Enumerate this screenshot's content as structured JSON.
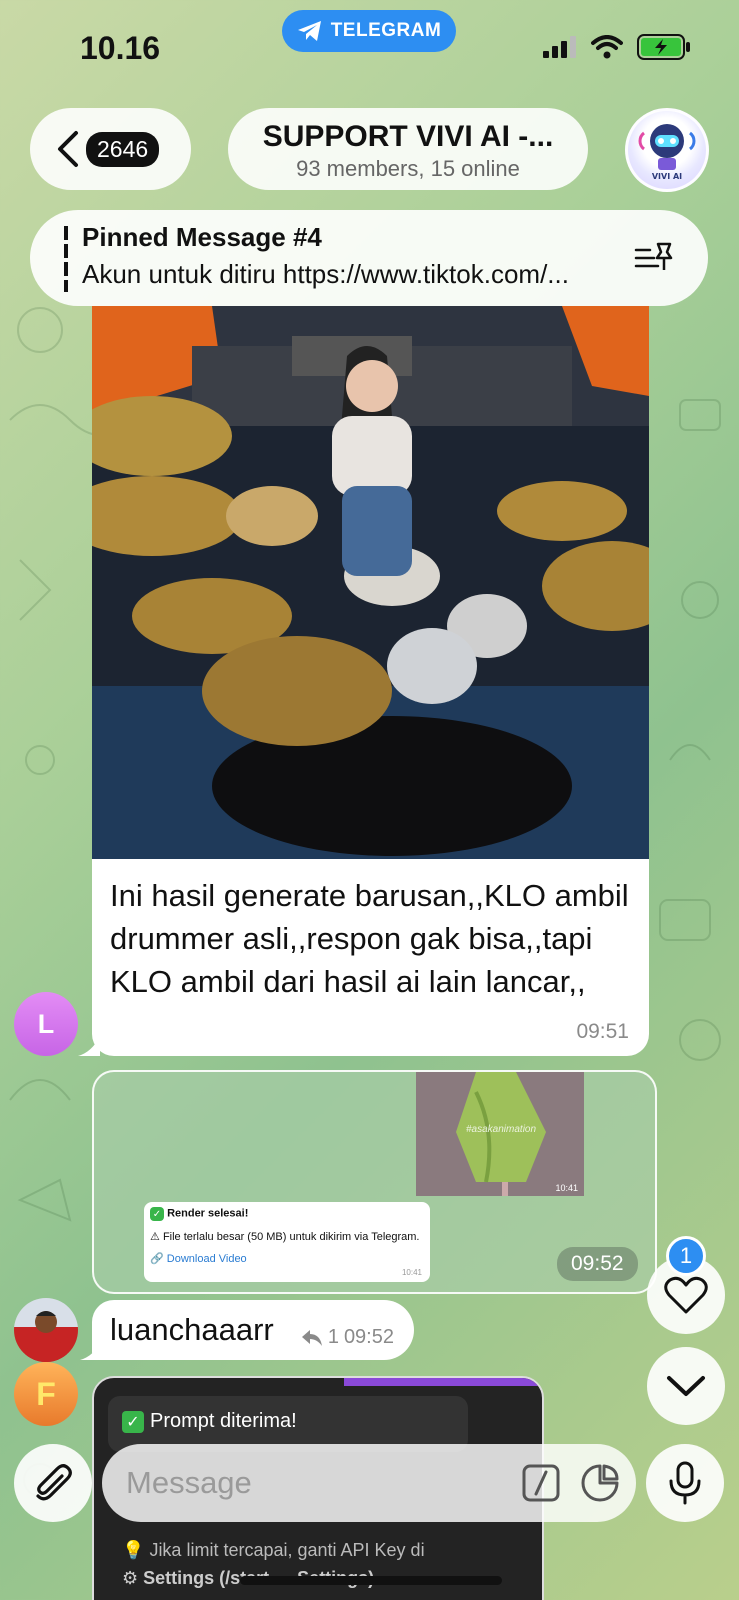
{
  "status": {
    "time": "10.16",
    "app_pill": "TELEGRAM"
  },
  "header": {
    "unread_count": "2646",
    "title": "SUPPORT VIVI AI -...",
    "subtitle": "93 members, 15 online",
    "avatar_text": "VIVI AI"
  },
  "pinned": {
    "heading": "Pinned Message #4",
    "body": "Akun untuk ditiru https://www.tiktok.com/..."
  },
  "messages": [
    {
      "text": "Ini hasil generate barusan,,KLO ambil drummer asli,,respon gak bisa,,tapi KLO ambil dari hasil ai lain lancar,,",
      "time": "09:51",
      "avatar_letter": "L"
    },
    {
      "thumb_time": "10:41",
      "thumb_watermark": "#asakanimation",
      "card_line1": "Render selesai!",
      "card_line2": "File terlalu besar (50 MB) untuk dikirim via Telegram.",
      "card_link": "Download Video",
      "card_time": "10:41",
      "time": "09:52"
    },
    {
      "sender": "luanchaaarr",
      "replies": "1",
      "time": "09:52"
    },
    {
      "line1": "Prompt diterima!",
      "line2": "Jika limit tercapai, ganti API Key di",
      "line3": "Settings (/start → Settings)",
      "avatar_letter": "F"
    }
  ],
  "input": {
    "placeholder": "Message"
  },
  "floating": {
    "reaction_badge": "1"
  },
  "colors": {
    "accent": "#2d8ef2",
    "avatar_L": "#d57ef0",
    "battery": "#38c43c"
  },
  "icons": [
    "telegram-icon",
    "signal-icon",
    "wifi-icon",
    "battery-icon",
    "chevron-left-icon",
    "pin-list-icon",
    "reply-icon",
    "heart-icon",
    "chevron-down-icon",
    "paperclip-icon",
    "command-icon",
    "sticker-icon",
    "microphone-icon"
  ]
}
